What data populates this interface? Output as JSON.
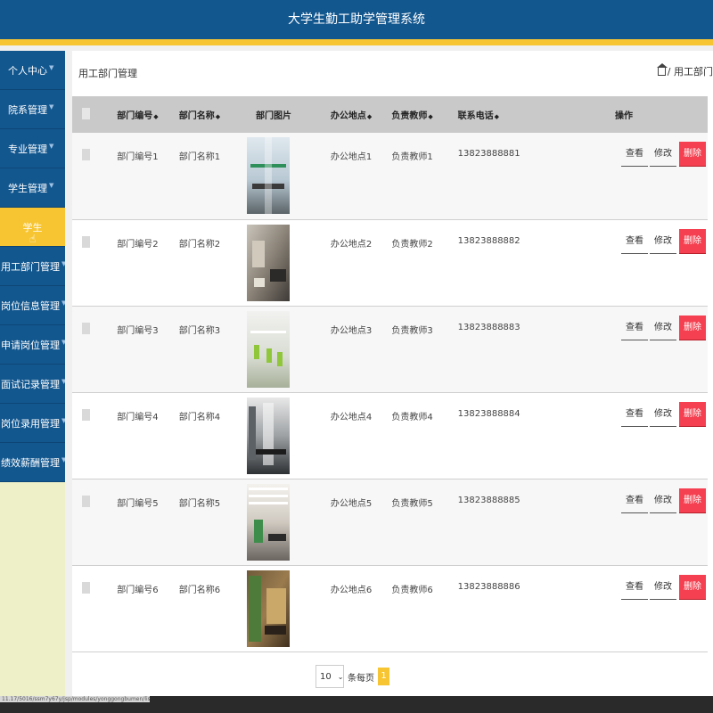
{
  "app_title": "大学生勤工助学管理系统",
  "colors": {
    "header": "#13578f",
    "accent": "#f7c531",
    "delete": "#f44050",
    "sidebar_bg": "#eef0c8"
  },
  "sidebar": {
    "items": [
      {
        "label": "个人中心"
      },
      {
        "label": "院系管理"
      },
      {
        "label": "专业管理"
      },
      {
        "label": "学生管理"
      },
      {
        "label": "学生",
        "active": true
      },
      {
        "label": "用工部门管理"
      },
      {
        "label": "岗位信息管理"
      },
      {
        "label": "申请岗位管理"
      },
      {
        "label": "面试记录管理"
      },
      {
        "label": "岗位录用管理"
      },
      {
        "label": "绩效薪酬管理"
      }
    ]
  },
  "page": {
    "title": "用工部门管理",
    "breadcrumb": "/ 用工部门"
  },
  "table": {
    "headers": {
      "dept_id": "部门编号",
      "dept_name": "部门名称",
      "dept_image": "部门图片",
      "office": "办公地点",
      "teacher": "负责教师",
      "phone": "联系电话",
      "ops": "操作"
    },
    "rows": [
      {
        "dept_id": "部门编号1",
        "dept_name": "部门名称1",
        "office": "办公地点1",
        "teacher": "负责教师1",
        "phone": "13823888881"
      },
      {
        "dept_id": "部门编号2",
        "dept_name": "部门名称2",
        "office": "办公地点2",
        "teacher": "负责教师2",
        "phone": "13823888882"
      },
      {
        "dept_id": "部门编号3",
        "dept_name": "部门名称3",
        "office": "办公地点3",
        "teacher": "负责教师3",
        "phone": "13823888883"
      },
      {
        "dept_id": "部门编号4",
        "dept_name": "部门名称4",
        "office": "办公地点4",
        "teacher": "负责教师4",
        "phone": "13823888884"
      },
      {
        "dept_id": "部门编号5",
        "dept_name": "部门名称5",
        "office": "办公地点5",
        "teacher": "负责教师5",
        "phone": "13823888885"
      },
      {
        "dept_id": "部门编号6",
        "dept_name": "部门名称6",
        "office": "办公地点6",
        "teacher": "负责教师6",
        "phone": "13823888886"
      }
    ],
    "actions": {
      "view": "查看",
      "edit": "修改",
      "delete": "删除"
    }
  },
  "pagination": {
    "page_size": "10",
    "per_page_label": "条每页",
    "current_page": "1"
  },
  "status_bar": {
    "url": "11.17/5016/ssm7y67y/jsp/modules/yonggongbumen/list.jsp#"
  }
}
